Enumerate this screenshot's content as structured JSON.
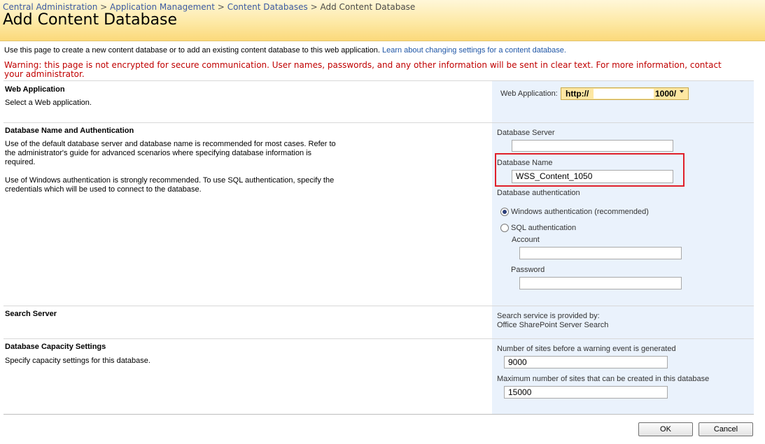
{
  "breadcrumb": {
    "items": [
      "Central Administration",
      "Application Management",
      "Content Databases"
    ],
    "current": "Add Content Database",
    "separator": ">"
  },
  "page": {
    "title": "Add Content Database",
    "intro": "Use this page to create a new content database or to add an existing content database to this web application.",
    "intro_link": "Learn about changing settings for a content database.",
    "warning": "Warning: this page is not encrypted for secure communication. User names, passwords, and any other information will be sent in clear text. For more information, contact your administrator."
  },
  "sections": {
    "web_application": {
      "title": "Web Application",
      "description": "Select a Web application.",
      "field_label": "Web Application:",
      "selector_value_left": "http://",
      "selector_value_right": "1000/"
    },
    "database": {
      "title": "Database Name and Authentication",
      "description_1": "Use of the default database server and database name is recommended for most cases. Refer to the administrator's guide for advanced scenarios where specifying database information is required.",
      "description_2": "Use of Windows authentication is strongly recommended. To use SQL authentication, specify the credentials which will be used to connect to the database.",
      "server_label": "Database Server",
      "server_value": "",
      "name_label": "Database Name",
      "name_value": "WSS_Content_1050",
      "auth_label": "Database authentication",
      "windows_auth_label": "Windows authentication (recommended)",
      "sql_auth_label": "SQL authentication",
      "account_label": "Account",
      "account_value": "",
      "password_label": "Password",
      "password_value": "",
      "selected_auth": "windows"
    },
    "search": {
      "title": "Search Server",
      "info_line1": "Search service is provided by:",
      "info_line2": "Office SharePoint Server Search"
    },
    "capacity": {
      "title": "Database Capacity Settings",
      "description": "Specify capacity settings for this database.",
      "warning_label": "Number of sites before a warning event is generated",
      "warning_value": "9000",
      "max_label": "Maximum number of sites that can be created in this database",
      "max_value": "15000"
    }
  },
  "buttons": {
    "ok": "OK",
    "cancel": "Cancel"
  },
  "colors": {
    "header_gradient_end": "#fbd97a",
    "warning_text": "#c00000",
    "link": "#1f56a6",
    "right_pane": "#eaf2fc",
    "highlight_box": "#e0202a"
  }
}
